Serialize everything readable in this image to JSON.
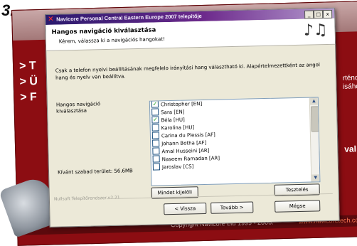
{
  "step_number": "3.",
  "background": {
    "menu_items": [
      "> T",
      "> Ü",
      "> F"
    ],
    "right_text_1": "rténo",
    "right_text_2": "isához",
    "right_text_3": "val",
    "copyright": "Copyright Navicore Ltd 1999 - 2006.",
    "url": "www.navicoretech.com"
  },
  "window": {
    "title": "Navicore Personal Central Eastern Europe 2007 telepítője",
    "controls": {
      "minimize": "_",
      "maximize": "□",
      "close": "x"
    },
    "header": {
      "title": "Hangos navigáció kiválasztása",
      "subtitle": "Kérem, válassza ki a navigációs hangokat!",
      "icon": "music-notes-icon"
    },
    "intro_text": "Csak a telefon nyelvi beállításának megfelelo irányítási hang választható ki. Alapértelmezettként az angol hang és nyelv van beállítva.",
    "sounds_label": "Hangos navigáció kiválasztása",
    "free_space_label": "Kívánt szabad terület: 56.6MB",
    "voices": [
      {
        "label": "Christopher [EN]",
        "checked": true
      },
      {
        "label": "Sara [EN]",
        "checked": false
      },
      {
        "label": "Béla [HU]",
        "checked": true
      },
      {
        "label": "Karolina [HU]",
        "checked": false
      },
      {
        "label": "Carina du Plessis [AF]",
        "checked": false
      },
      {
        "label": "Johann Botha [AF]",
        "checked": false
      },
      {
        "label": "Amal Husseini [AR]",
        "checked": false
      },
      {
        "label": "Naseem Ramadan [AR]",
        "checked": false
      },
      {
        "label": "Jaroslav [CS]",
        "checked": false
      }
    ],
    "buttons": {
      "select_all": "Mindet kijelöli",
      "test": "Tesztelés",
      "back": "< Vissza",
      "next": "Tovább >",
      "cancel": "Mégse"
    },
    "nullsoft_label": "Nullsoft Telepítőrendszer v2.21"
  }
}
